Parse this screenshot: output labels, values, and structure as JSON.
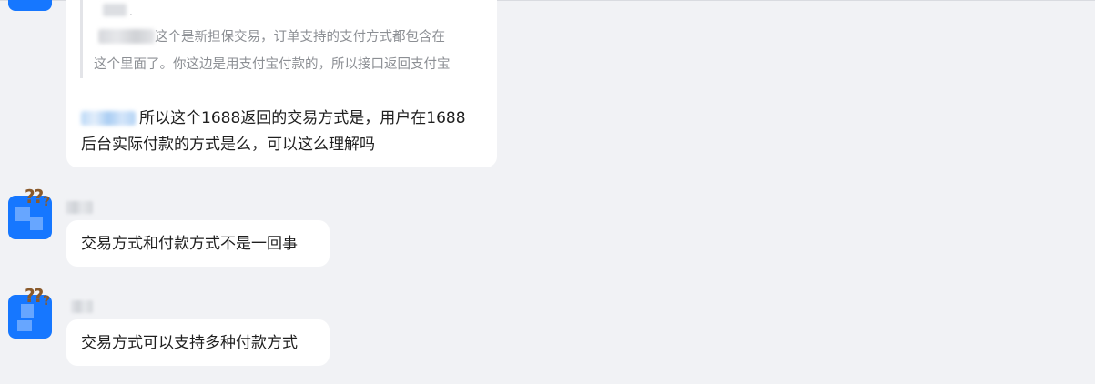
{
  "messages": [
    {
      "quote": {
        "line1": "这个是新担保交易，订单支持的支付方式都包含在",
        "line2": "这个里面了。你这边是用支付宝付款的，所以接口返回支付宝"
      },
      "text_line1": "所以这个1688返回的交易方式是，用户在1688",
      "text_line2": "后台实际付款的方式是么，可以这么理解吗"
    },
    {
      "text": "交易方式和付款方式不是一回事"
    },
    {
      "text": "交易方式可以支持多种付款方式"
    }
  ],
  "colors": {
    "background": "#f1f2f5",
    "bubble": "#ffffff",
    "avatar": "#1677ff",
    "quote_text": "#8c8f94",
    "message_text": "#1f1f1f"
  },
  "icons": {
    "avatar_badge": "question-marks-icon"
  }
}
